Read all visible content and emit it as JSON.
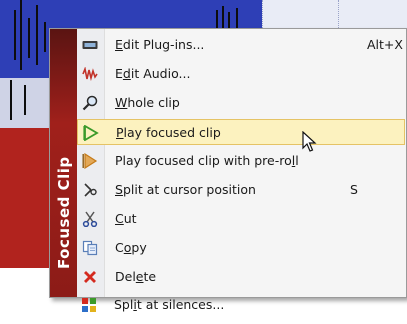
{
  "menu": {
    "title": "Focused Clip",
    "items": [
      {
        "label": "Edit Plug-ins...",
        "shortcut": "Alt+X",
        "icon": "plugin-icon"
      },
      {
        "label": "Edit Audio...",
        "shortcut": "",
        "icon": "waveform-icon"
      },
      {
        "label": "Whole clip",
        "shortcut": "",
        "icon": "magnifier-icon"
      },
      {
        "label": "Play focused clip",
        "shortcut": "",
        "icon": "play-icon",
        "highlighted": true
      },
      {
        "label": "Play focused clip with pre-roll",
        "shortcut": "",
        "icon": "play-preroll-icon"
      },
      {
        "label": "Split at cursor position",
        "shortcut": "S",
        "icon": "split-cursor-icon"
      },
      {
        "label": "Cut",
        "shortcut": "",
        "icon": "scissors-icon"
      },
      {
        "label": "Copy",
        "shortcut": "",
        "icon": "copy-icon"
      },
      {
        "label": "Delete",
        "shortcut": "",
        "icon": "delete-icon"
      },
      {
        "label": "Split at silences...",
        "shortcut": "",
        "icon": "split-silences-icon"
      }
    ]
  },
  "colors": {
    "sidebar": "#a0201b",
    "highlight_bg": "#fcf2bf",
    "highlight_border": "#e5c365",
    "play_green": "#3b9a2a",
    "play_orange": "#d98a1c",
    "delete_red": "#d42a1f"
  }
}
